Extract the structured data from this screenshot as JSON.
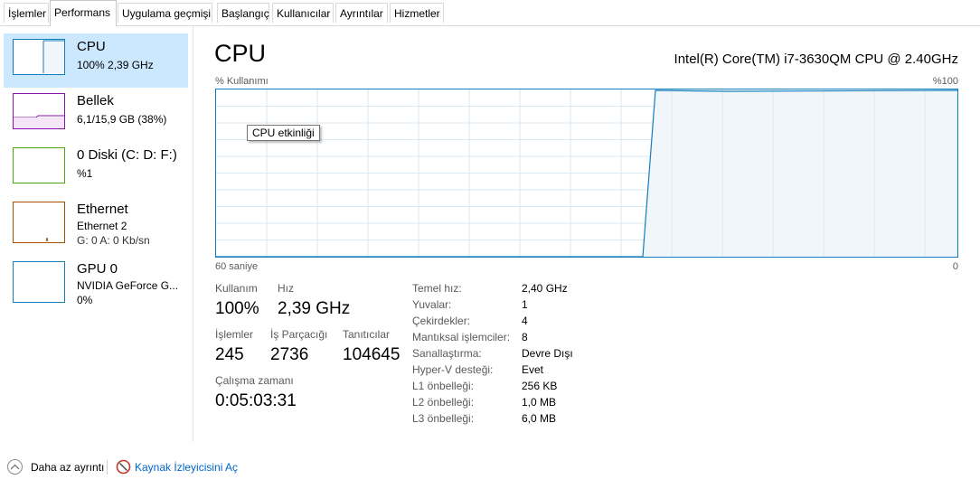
{
  "tabs": [
    "İşlemler",
    "Performans",
    "Uygulama geçmişi",
    "Başlangıç",
    "Kullanıcılar",
    "Ayrıntılar",
    "Hizmetler"
  ],
  "active_tab": "Performans",
  "sidebar": {
    "items": [
      {
        "title": "CPU",
        "sub1": "100% 2,39 GHz",
        "sub2": "",
        "color": "#117dbb",
        "selected": true
      },
      {
        "title": "Bellek",
        "sub1": "6,1/15,9 GB (38%)",
        "sub2": "",
        "color": "#8b12ae",
        "selected": false
      },
      {
        "title": "0 Diski (C: D: F:)",
        "sub1": "%1",
        "sub2": "",
        "color": "#4da60c",
        "selected": false
      },
      {
        "title": "Ethernet",
        "sub1": "Ethernet 2",
        "sub2": "G: 0 A: 0 Kb/sn",
        "color": "#a74f01",
        "selected": false
      },
      {
        "title": "GPU 0",
        "sub1": "NVIDIA GeForce G...",
        "sub2": "0%",
        "color": "#117dbb",
        "selected": false
      }
    ]
  },
  "main": {
    "title": "CPU",
    "model": "Intel(R) Core(TM) i7-3630QM CPU @ 2.40GHz",
    "graph_label_left": "% Kullanımı",
    "graph_label_right": "%100",
    "graph_bottom_left": "60 saniye",
    "graph_bottom_right": "0",
    "tooltip": "CPU etkinliği",
    "stats": {
      "usage_label": "Kullanım",
      "usage_value": "100%",
      "speed_label": "Hız",
      "speed_value": "2,39 GHz",
      "processes_label": "İşlemler",
      "processes_value": "245",
      "threads_label": "İş Parçacığı",
      "threads_value": "2736",
      "handles_label": "Tanıtıcılar",
      "handles_value": "104645",
      "uptime_label": "Çalışma zamanı",
      "uptime_value": "0:05:03:31"
    },
    "specs": [
      {
        "k": "Temel hız:",
        "v": "2,40 GHz"
      },
      {
        "k": "Yuvalar:",
        "v": "1"
      },
      {
        "k": "Çekirdekler:",
        "v": "4"
      },
      {
        "k": "Mantıksal işlemciler:",
        "v": "8"
      },
      {
        "k": "Sanallaştırma:",
        "v": "Devre Dışı"
      },
      {
        "k": "Hyper-V desteği:",
        "v": "Evet"
      },
      {
        "k": "L1 önbelleği:",
        "v": "256 KB"
      },
      {
        "k": "L2 önbelleği:",
        "v": "1,0 MB"
      },
      {
        "k": "L3 önbelleği:",
        "v": "6,0 MB"
      }
    ]
  },
  "footer": {
    "less_details": "Daha az ayrıntı",
    "resource_monitor": "Kaynak İzleyicisini Aç"
  },
  "colors": {
    "cpu": "#117dbb",
    "selection": "#cce8ff",
    "link": "#0066cc"
  }
}
